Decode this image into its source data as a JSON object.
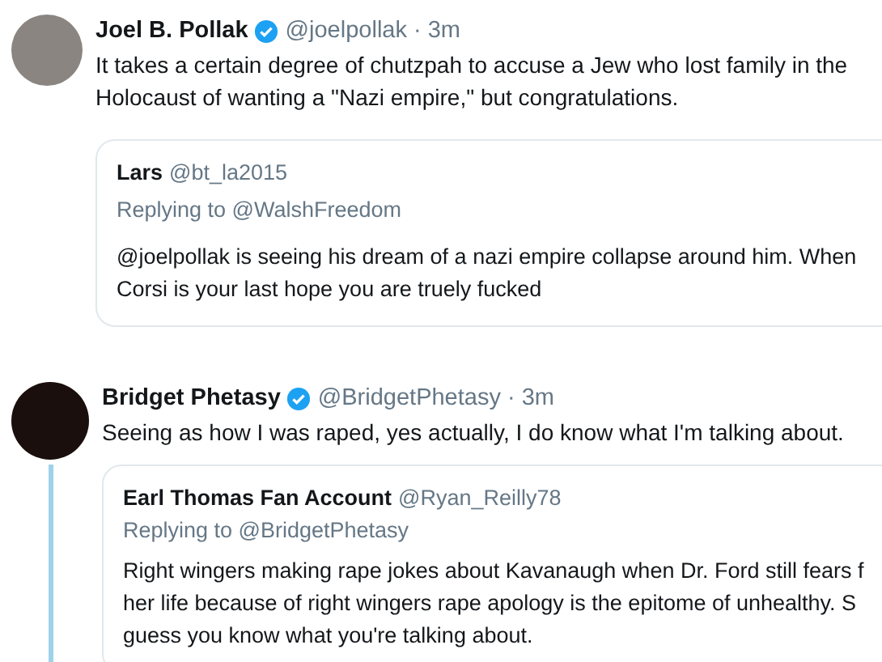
{
  "tweets": [
    {
      "name": "Joel B. Pollak",
      "verified": true,
      "handle": "@joelpollak",
      "separator": "·",
      "time": "3m",
      "text": "It takes a certain degree of chutzpah to accuse a Jew who lost family in the Holocaust of wanting a \"Nazi empire,\" but congratulations.",
      "thread_line": false,
      "quote": {
        "name": "Lars",
        "handle": "@bt_la2015",
        "replying_to": "Replying to @WalshFreedom",
        "lines": [
          "@joelpollak is seeing his dream of a nazi empire collapse around him. When",
          "Corsi is your last hope you are truely fucked"
        ]
      }
    },
    {
      "name": "Bridget Phetasy",
      "verified": true,
      "handle": "@BridgetPhetasy",
      "separator": "·",
      "time": "3m",
      "text": "Seeing as how I was raped, yes actually, I do know what I'm talking about.",
      "thread_line": true,
      "quote": {
        "name": "Earl Thomas Fan Account",
        "handle": "@Ryan_Reilly78",
        "replying_to": "Replying to @BridgetPhetasy",
        "lines": [
          "Right wingers making rape jokes about Kavanaugh when Dr. Ford still fears f",
          "her life because of right wingers rape apology is the epitome of unhealthy. S",
          "guess you know what you're talking about."
        ]
      }
    }
  ]
}
